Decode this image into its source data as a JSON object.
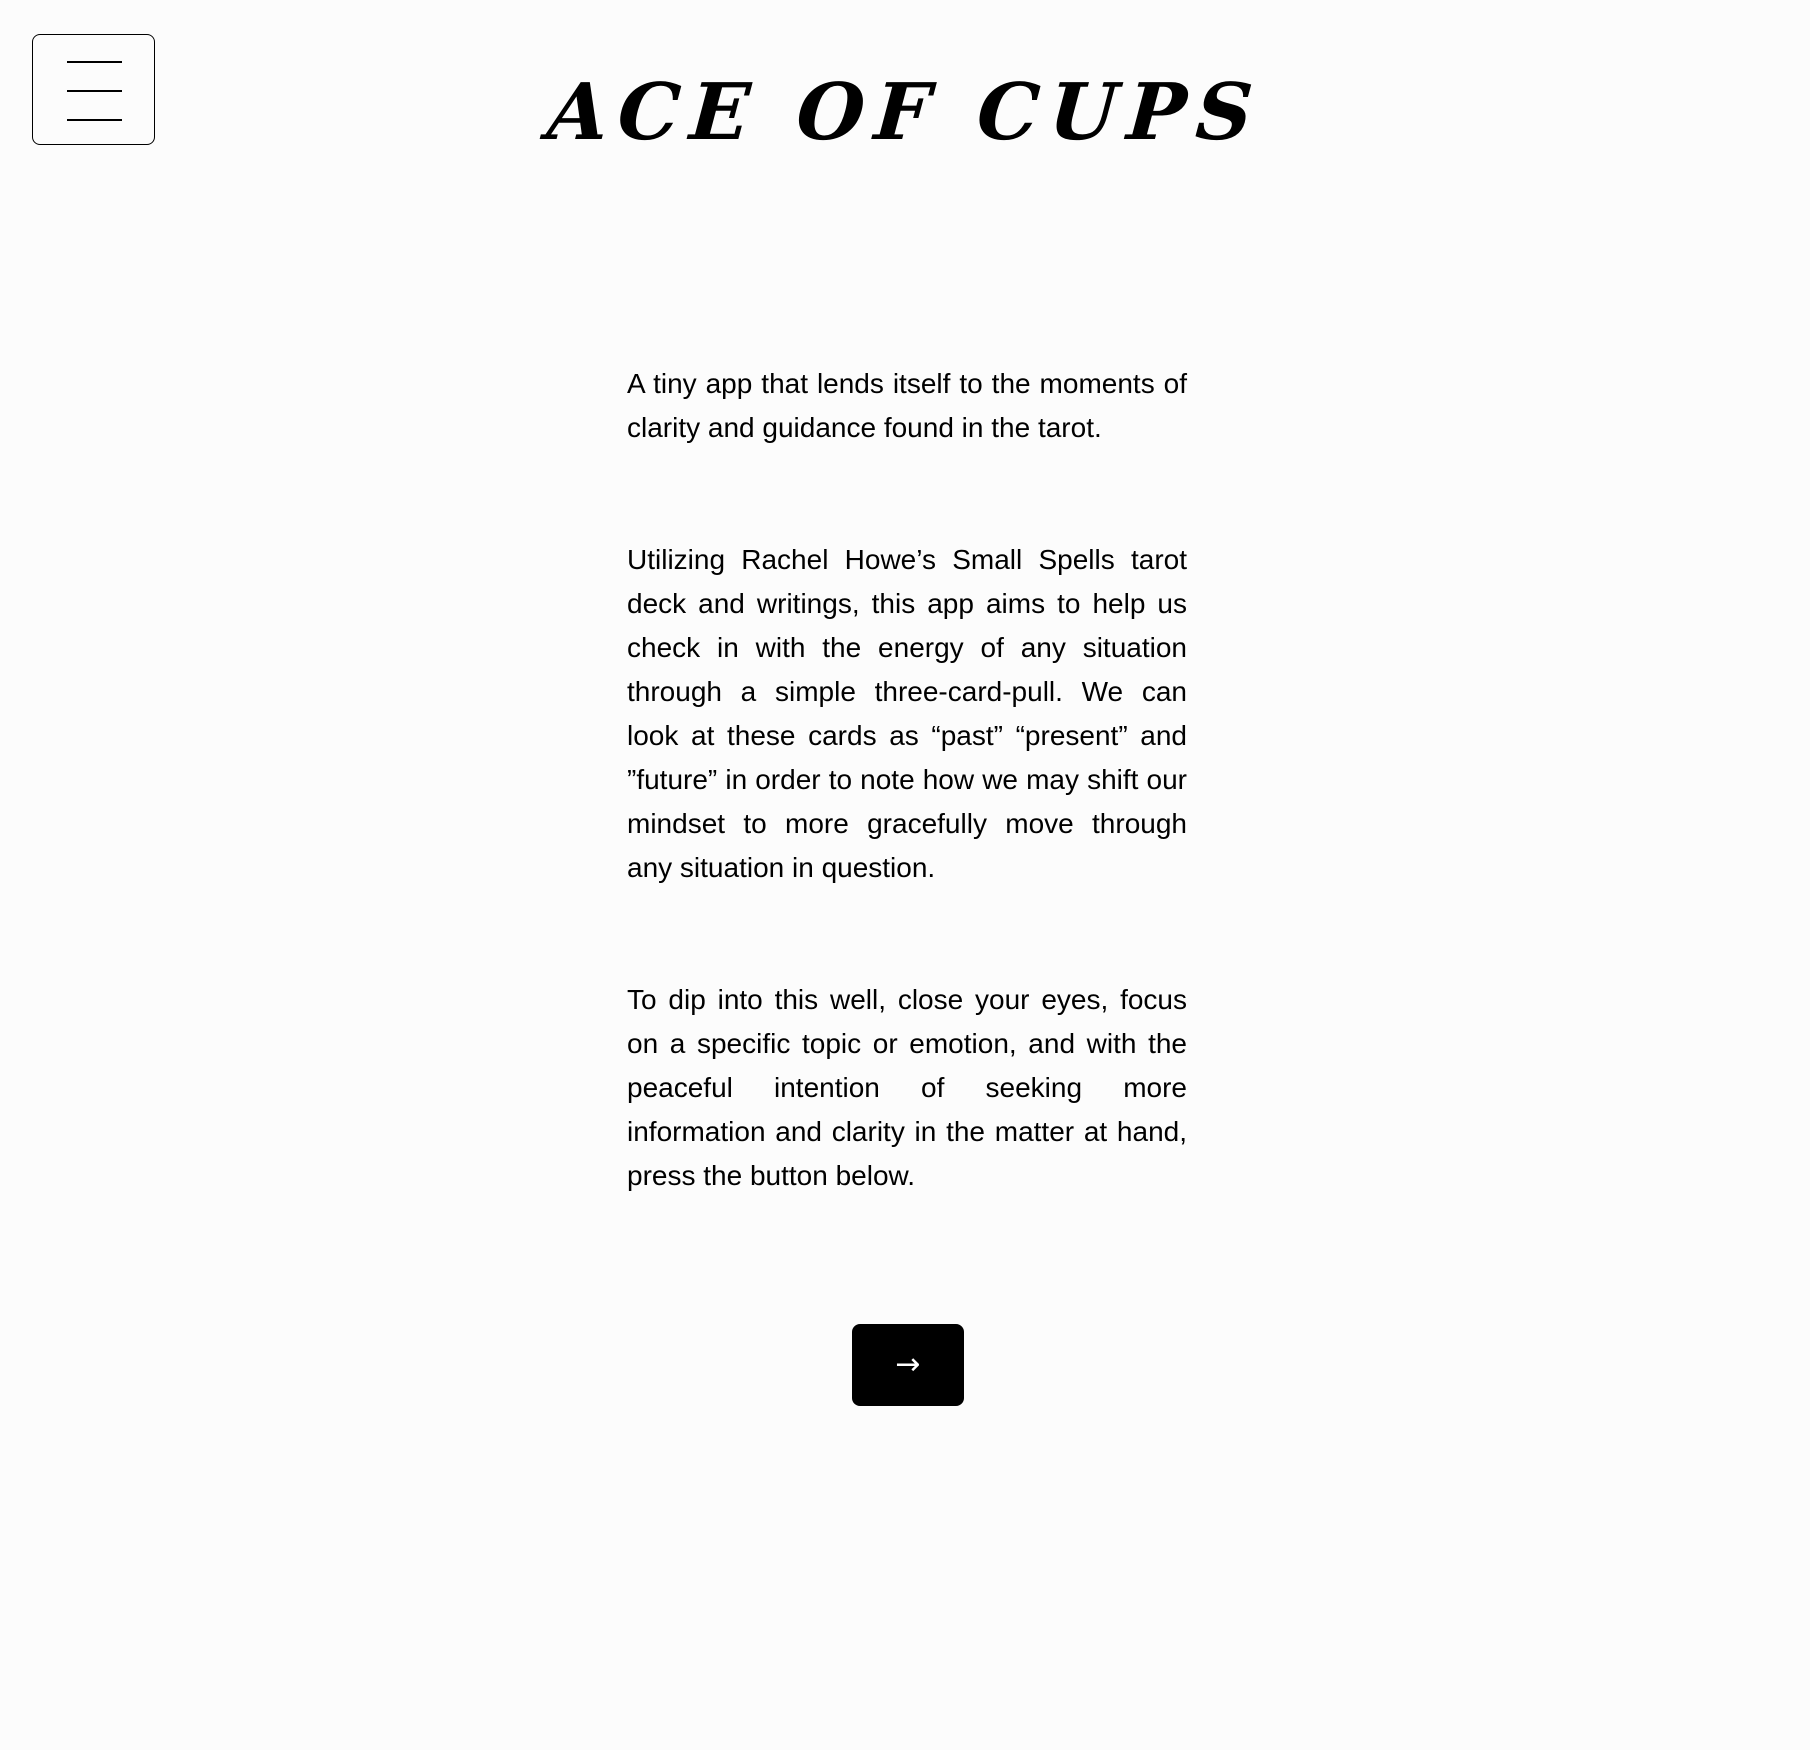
{
  "header": {
    "menu_icon": "hamburger-menu-icon",
    "logo_text": "ACE OF CUPS"
  },
  "intro": {
    "paragraphs": [
      "A tiny app that lends itself to the moments of clarity and guidance found in the tarot.",
      "Utilizing Rachel Howe’s Small Spells tarot deck and writings, this app aims to help us check in with the energy of any situation through a simple three-card-pull. We can look at these cards as “past” “present” and ”future” in order to note how we may shift our mindset to more gracefully move through any situation in question.",
      "To dip into this well, close your eyes, focus on a specific topic or emotion, and with the peaceful intention of seeking more information and clarity in the matter at hand, press the button below."
    ]
  },
  "action": {
    "button_label": "→",
    "button_icon": "arrow-right-icon"
  },
  "colors": {
    "background": "#fcfcfc",
    "text": "#000000",
    "button_bg": "#000000",
    "button_text": "#ffffff"
  }
}
